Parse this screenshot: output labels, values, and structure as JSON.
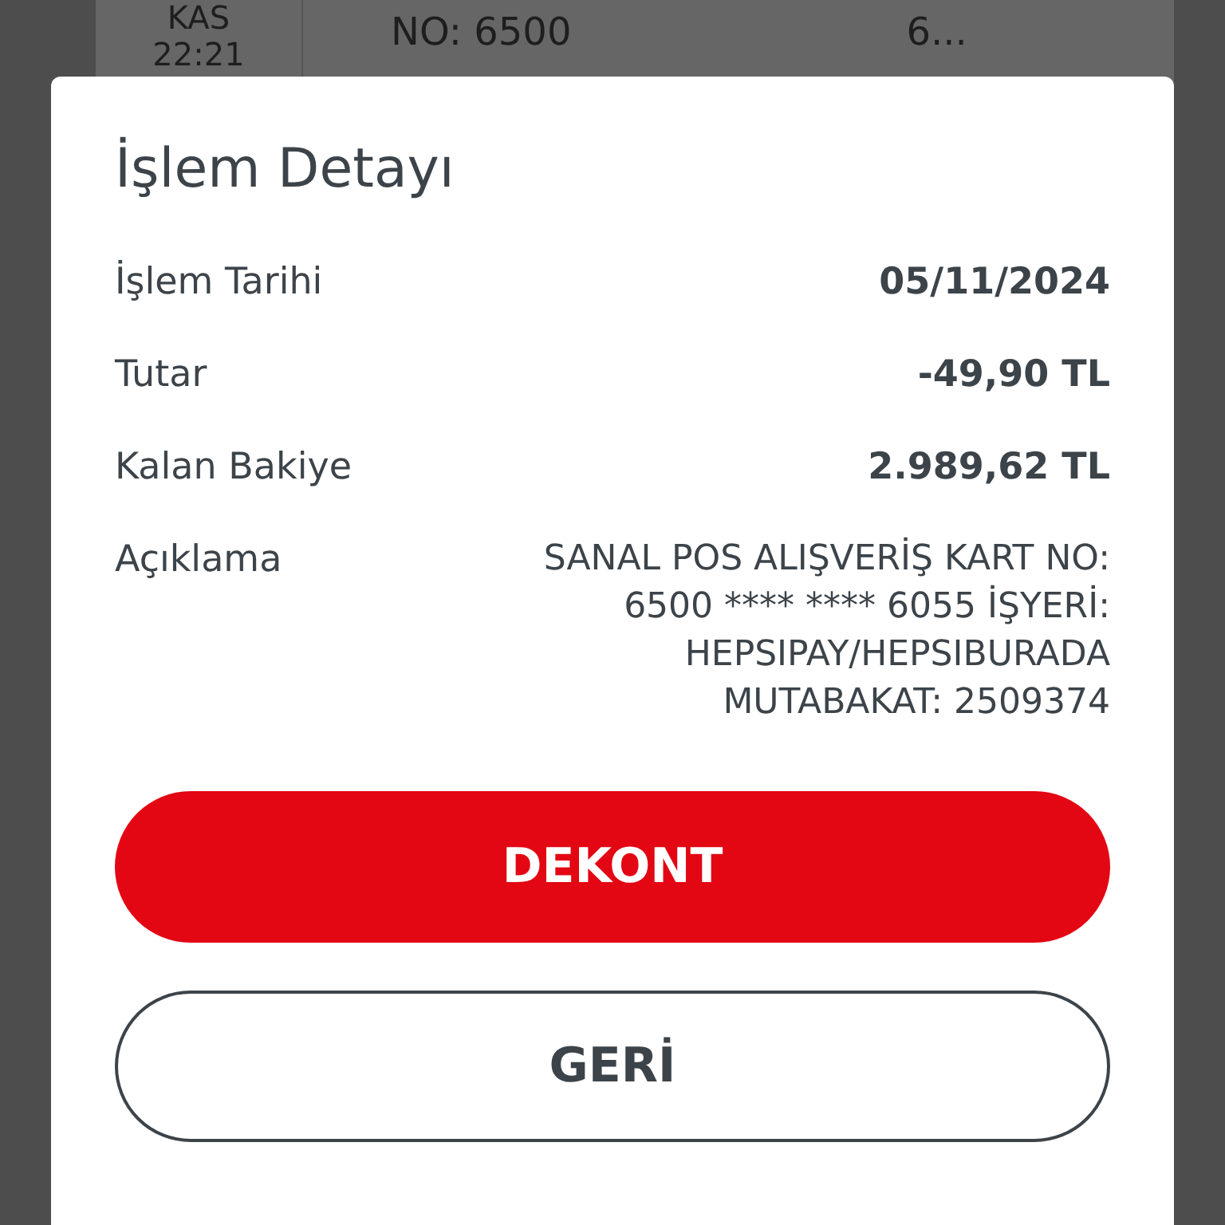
{
  "background_list": {
    "date_lines": [
      "KAS",
      "22:21"
    ],
    "description": "NO: 6500",
    "amount": "6..."
  },
  "dialog": {
    "title": "İşlem Detayı",
    "rows": [
      {
        "label": "İşlem Tarihi",
        "value": "05/11/2024",
        "kind": "bold"
      },
      {
        "label": "Tutar",
        "value": "-49,90 TL",
        "kind": "bold"
      },
      {
        "label": "Kalan Bakiye",
        "value": "2.989,62 TL",
        "kind": "bold"
      },
      {
        "label": "Açıklama",
        "value": "SANAL POS ALIŞVERİŞ KART NO: 6500 **** **** 6055 İŞYERİ: HEPSIPAY/HEPSIBURADA MUTABAKAT: 2509374",
        "kind": "plain"
      }
    ],
    "buttons": [
      {
        "label": "DEKONT",
        "kind": "primary"
      },
      {
        "label": "GERİ",
        "kind": "outline"
      }
    ]
  }
}
